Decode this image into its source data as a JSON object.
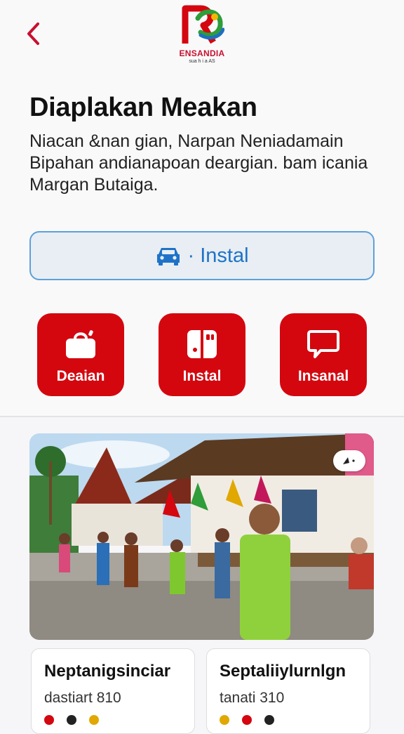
{
  "header": {
    "back_icon": "chevron-left-icon",
    "logo_text": "ENSANDIA",
    "logo_subtext": "sua  h  i  a  AS"
  },
  "hero": {
    "title": "Diaplakan Meakan",
    "description": "Niacan &nan gian,  Narpan Neniadamain Bipahan andianapoan deargian. bam icania Margan Butaiga."
  },
  "install_bar": {
    "icon": "car-icon",
    "label": "· Instal"
  },
  "tiles": [
    {
      "icon": "bag-icon",
      "label": "Deaian"
    },
    {
      "icon": "tablet-icon",
      "label": "Instal"
    },
    {
      "icon": "chat-bubble-icon",
      "label": "Insanal"
    }
  ],
  "photo": {
    "location_icon": "location-arrow-icon"
  },
  "cards": [
    {
      "title": "Neptanigsinciar",
      "subtitle": "dastiart 810"
    },
    {
      "title": "Septaliiylurnlgn",
      "subtitle": "tanati 310"
    }
  ],
  "colors": {
    "brand_red": "#d4070f",
    "accent_blue": "#1e73c8",
    "bar_border": "#5ea0d9",
    "bar_bg": "#e8eef3"
  }
}
